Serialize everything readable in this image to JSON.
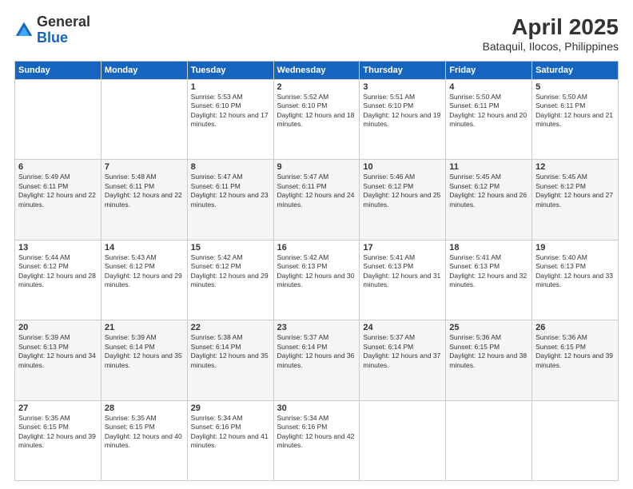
{
  "header": {
    "logo_general": "General",
    "logo_blue": "Blue",
    "title": "April 2025",
    "subtitle": "Bataquil, Ilocos, Philippines"
  },
  "days_of_week": [
    "Sunday",
    "Monday",
    "Tuesday",
    "Wednesday",
    "Thursday",
    "Friday",
    "Saturday"
  ],
  "weeks": [
    [
      {
        "day": null
      },
      {
        "day": null
      },
      {
        "day": "1",
        "sunrise": "5:53 AM",
        "sunset": "6:10 PM",
        "daylight": "12 hours and 17 minutes."
      },
      {
        "day": "2",
        "sunrise": "5:52 AM",
        "sunset": "6:10 PM",
        "daylight": "12 hours and 18 minutes."
      },
      {
        "day": "3",
        "sunrise": "5:51 AM",
        "sunset": "6:10 PM",
        "daylight": "12 hours and 19 minutes."
      },
      {
        "day": "4",
        "sunrise": "5:50 AM",
        "sunset": "6:11 PM",
        "daylight": "12 hours and 20 minutes."
      },
      {
        "day": "5",
        "sunrise": "5:50 AM",
        "sunset": "6:11 PM",
        "daylight": "12 hours and 21 minutes."
      }
    ],
    [
      {
        "day": "6",
        "sunrise": "5:49 AM",
        "sunset": "6:11 PM",
        "daylight": "12 hours and 22 minutes."
      },
      {
        "day": "7",
        "sunrise": "5:48 AM",
        "sunset": "6:11 PM",
        "daylight": "12 hours and 22 minutes."
      },
      {
        "day": "8",
        "sunrise": "5:47 AM",
        "sunset": "6:11 PM",
        "daylight": "12 hours and 23 minutes."
      },
      {
        "day": "9",
        "sunrise": "5:47 AM",
        "sunset": "6:11 PM",
        "daylight": "12 hours and 24 minutes."
      },
      {
        "day": "10",
        "sunrise": "5:46 AM",
        "sunset": "6:12 PM",
        "daylight": "12 hours and 25 minutes."
      },
      {
        "day": "11",
        "sunrise": "5:45 AM",
        "sunset": "6:12 PM",
        "daylight": "12 hours and 26 minutes."
      },
      {
        "day": "12",
        "sunrise": "5:45 AM",
        "sunset": "6:12 PM",
        "daylight": "12 hours and 27 minutes."
      }
    ],
    [
      {
        "day": "13",
        "sunrise": "5:44 AM",
        "sunset": "6:12 PM",
        "daylight": "12 hours and 28 minutes."
      },
      {
        "day": "14",
        "sunrise": "5:43 AM",
        "sunset": "6:12 PM",
        "daylight": "12 hours and 29 minutes."
      },
      {
        "day": "15",
        "sunrise": "5:42 AM",
        "sunset": "6:12 PM",
        "daylight": "12 hours and 29 minutes."
      },
      {
        "day": "16",
        "sunrise": "5:42 AM",
        "sunset": "6:13 PM",
        "daylight": "12 hours and 30 minutes."
      },
      {
        "day": "17",
        "sunrise": "5:41 AM",
        "sunset": "6:13 PM",
        "daylight": "12 hours and 31 minutes."
      },
      {
        "day": "18",
        "sunrise": "5:41 AM",
        "sunset": "6:13 PM",
        "daylight": "12 hours and 32 minutes."
      },
      {
        "day": "19",
        "sunrise": "5:40 AM",
        "sunset": "6:13 PM",
        "daylight": "12 hours and 33 minutes."
      }
    ],
    [
      {
        "day": "20",
        "sunrise": "5:39 AM",
        "sunset": "6:13 PM",
        "daylight": "12 hours and 34 minutes."
      },
      {
        "day": "21",
        "sunrise": "5:39 AM",
        "sunset": "6:14 PM",
        "daylight": "12 hours and 35 minutes."
      },
      {
        "day": "22",
        "sunrise": "5:38 AM",
        "sunset": "6:14 PM",
        "daylight": "12 hours and 35 minutes."
      },
      {
        "day": "23",
        "sunrise": "5:37 AM",
        "sunset": "6:14 PM",
        "daylight": "12 hours and 36 minutes."
      },
      {
        "day": "24",
        "sunrise": "5:37 AM",
        "sunset": "6:14 PM",
        "daylight": "12 hours and 37 minutes."
      },
      {
        "day": "25",
        "sunrise": "5:36 AM",
        "sunset": "6:15 PM",
        "daylight": "12 hours and 38 minutes."
      },
      {
        "day": "26",
        "sunrise": "5:36 AM",
        "sunset": "6:15 PM",
        "daylight": "12 hours and 39 minutes."
      }
    ],
    [
      {
        "day": "27",
        "sunrise": "5:35 AM",
        "sunset": "6:15 PM",
        "daylight": "12 hours and 39 minutes."
      },
      {
        "day": "28",
        "sunrise": "5:35 AM",
        "sunset": "6:15 PM",
        "daylight": "12 hours and 40 minutes."
      },
      {
        "day": "29",
        "sunrise": "5:34 AM",
        "sunset": "6:16 PM",
        "daylight": "12 hours and 41 minutes."
      },
      {
        "day": "30",
        "sunrise": "5:34 AM",
        "sunset": "6:16 PM",
        "daylight": "12 hours and 42 minutes."
      },
      {
        "day": null
      },
      {
        "day": null
      },
      {
        "day": null
      }
    ]
  ]
}
